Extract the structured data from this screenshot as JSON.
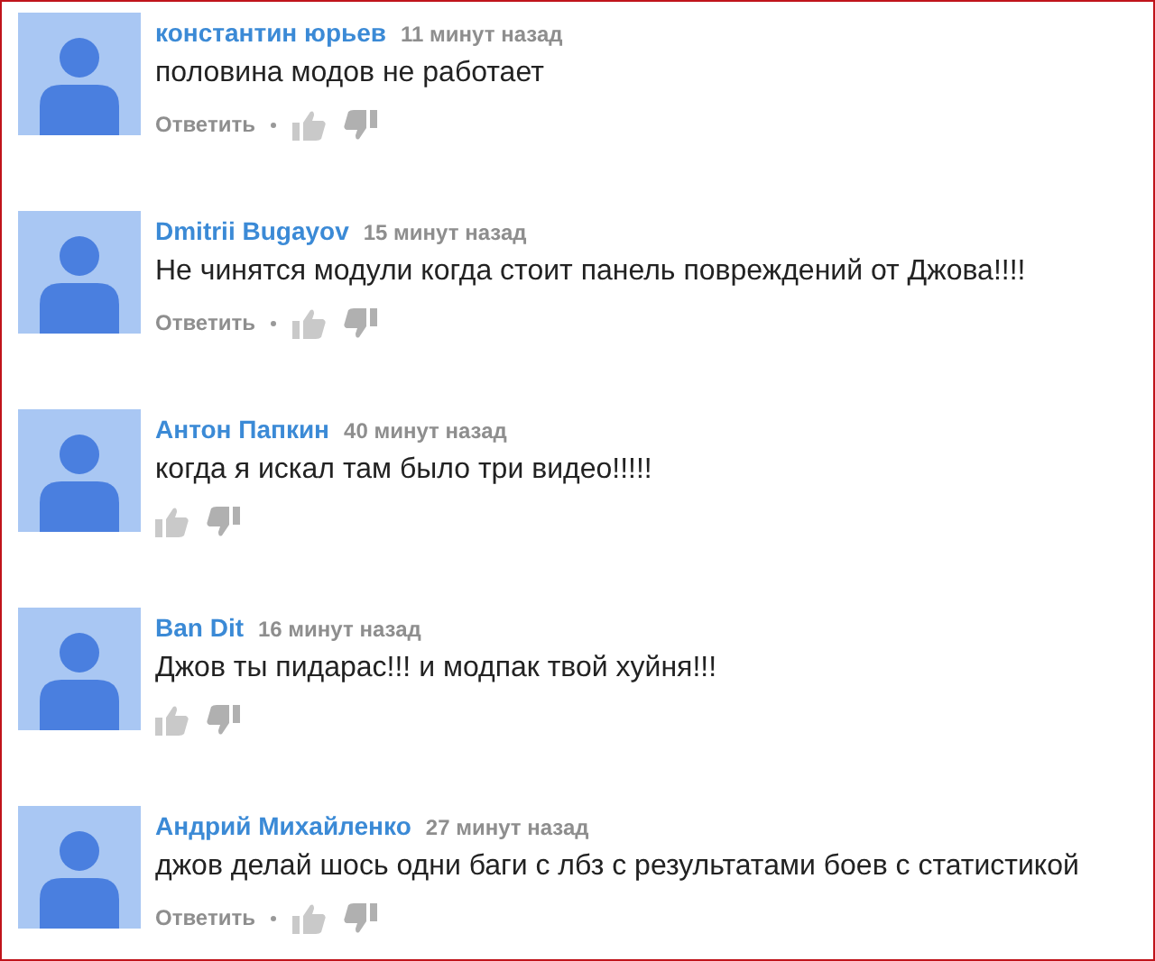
{
  "comments": [
    {
      "author": "константин юрьев",
      "time": "11 минут назад",
      "text": "половина модов не работает",
      "reply": "Ответить"
    },
    {
      "author": "Dmitrii Bugayov",
      "time": "15 минут назад",
      "text": "Не чинятся модули когда стоит панель повреждений от Джова!!!!",
      "reply": "Ответить"
    },
    {
      "author": "Антон Папкин",
      "time": "40 минут назад",
      "text": "когда я искал там было три видео!!!!!"
    },
    {
      "author": "Ban Dit",
      "time": "16 минут назад",
      "text": "Джов ты пидарас!!! и модпак твой хуйня!!!"
    },
    {
      "author": "Андрий Михайленко",
      "time": "27 минут назад",
      "text": "джов делай шось одни баги с лбз с результатами боев с статистикой",
      "reply": "Ответить"
    }
  ]
}
